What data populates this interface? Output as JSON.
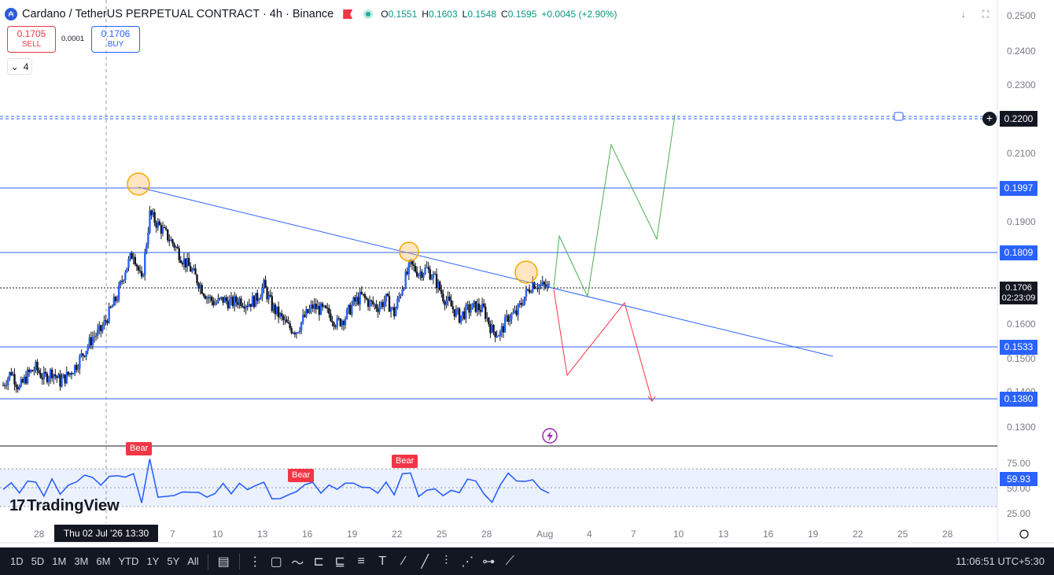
{
  "header": {
    "symbol": "Cardano / TetherUS PERPETUAL CONTRACT · 4h · Binance",
    "ohlc": [
      {
        "k": "O",
        "v": "0.1551"
      },
      {
        "k": "H",
        "v": "0.1603"
      },
      {
        "k": "L",
        "v": "0.1548"
      },
      {
        "k": "C",
        "v": "0.1595"
      }
    ],
    "change": "+0.0045 (+2.90%)",
    "coin_icon": "cardano-coin-icon",
    "flag_icon": "flag-icon",
    "status_icon": "market-open-dot-icon"
  },
  "trade": {
    "sell_price": "0.1705",
    "sell_label": "SELL",
    "spread": "0.0001",
    "buy_price": "0.1706",
    "buy_label": "BUY"
  },
  "indicators_count": "4",
  "price_axis": {
    "ticks": [
      "0.2500",
      "0.2400",
      "0.2300",
      "0.2100",
      "0.1900",
      "0.1600",
      "0.1500",
      "0.1400",
      "0.1300"
    ],
    "levels": [
      "0.2200",
      "0.1997",
      "0.1809",
      "0.1533",
      "0.1380"
    ],
    "current_price": "0.1706",
    "countdown": "02:23:09"
  },
  "rsi": {
    "value": "59.93",
    "ticks": [
      "75.00",
      "50.00",
      "25.00"
    ],
    "bear_label": "Bear"
  },
  "time_axis": {
    "labels": [
      "28",
      "7",
      "10",
      "13",
      "16",
      "19",
      "22",
      "25",
      "28",
      "Aug",
      "4",
      "7",
      "10",
      "13",
      "16",
      "19",
      "22",
      "25",
      "28"
    ],
    "crosshair": "Thu 02 Jul '26    13:30"
  },
  "logo_text": "TradingView",
  "bottom": {
    "timeframes": [
      "1D",
      "5D",
      "1M",
      "3M",
      "6M",
      "YTD",
      "1Y",
      "5Y",
      "All"
    ],
    "clock": "11:06:51 UTC+5:30"
  },
  "chart_data": {
    "type": "candlestick",
    "series": [
      {
        "name": "",
        "values": [
          0.142,
          0.146,
          0.141,
          0.145,
          0.147,
          0.144,
          0.146,
          0.143,
          0.145,
          0.148,
          0.152,
          0.156,
          0.158,
          0.163,
          0.168,
          0.176,
          0.181,
          0.172,
          0.192,
          0.189,
          0.186,
          0.183,
          0.179,
          0.176,
          0.172,
          0.168,
          0.166,
          0.167,
          0.166,
          0.167,
          0.166,
          0.167,
          0.171,
          0.165,
          0.162,
          0.159,
          0.158,
          0.162,
          0.165,
          0.164,
          0.163,
          0.16,
          0.162,
          0.166,
          0.168,
          0.166,
          0.165,
          0.167,
          0.163,
          0.171,
          0.177,
          0.175,
          0.176,
          0.173,
          0.168,
          0.165,
          0.162,
          0.164,
          0.165,
          0.164,
          0.158,
          0.157,
          0.162,
          0.163,
          0.168,
          0.172,
          0.171,
          0.1706
        ]
      }
    ],
    "horizontal_levels": [
      0.22,
      0.1997,
      0.1809,
      0.1706,
      0.1533,
      0.138
    ],
    "ylim": [
      0.125,
      0.255
    ]
  }
}
